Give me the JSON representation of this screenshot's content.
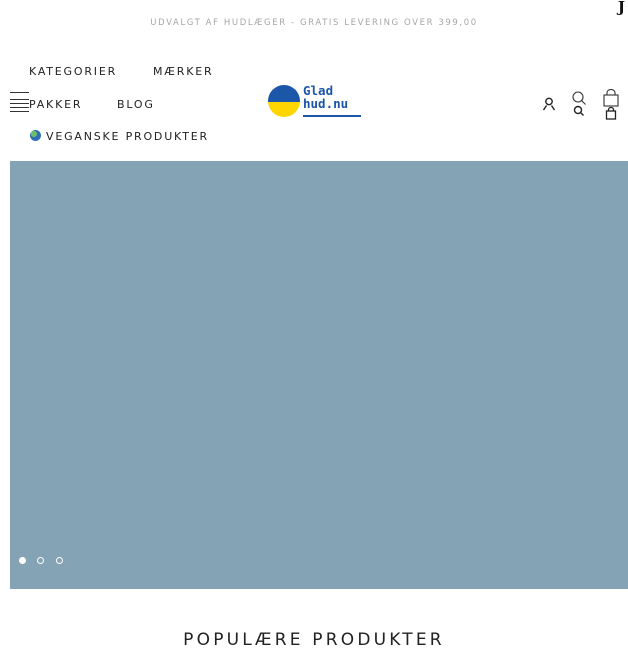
{
  "announcement": {
    "text": "UDVALGT AF HUDLÆGER - GRATIS LEVERING OVER 399,00",
    "corner_mark": "J"
  },
  "nav": {
    "kategorier": "KATEGORIER",
    "maerker": "MÆRKER",
    "pakker": "PAKKER",
    "blog": "BLOG",
    "vegan": "VEGANSKE PRODUKTER",
    "vegan_icon": "globe-icon"
  },
  "logo": {
    "line1": "Glad",
    "line2": "hud.nu",
    "colors": {
      "top": "#1b56a8",
      "bottom": "#ffd500"
    }
  },
  "header_icons": [
    "menu-icon",
    "account-icon",
    "search-icon",
    "cart-icon"
  ],
  "hero": {
    "background_color": "#84a3b5",
    "slides": 3,
    "active_slide": 1
  },
  "section": {
    "title": "POPULÆRE PRODUKTER"
  }
}
